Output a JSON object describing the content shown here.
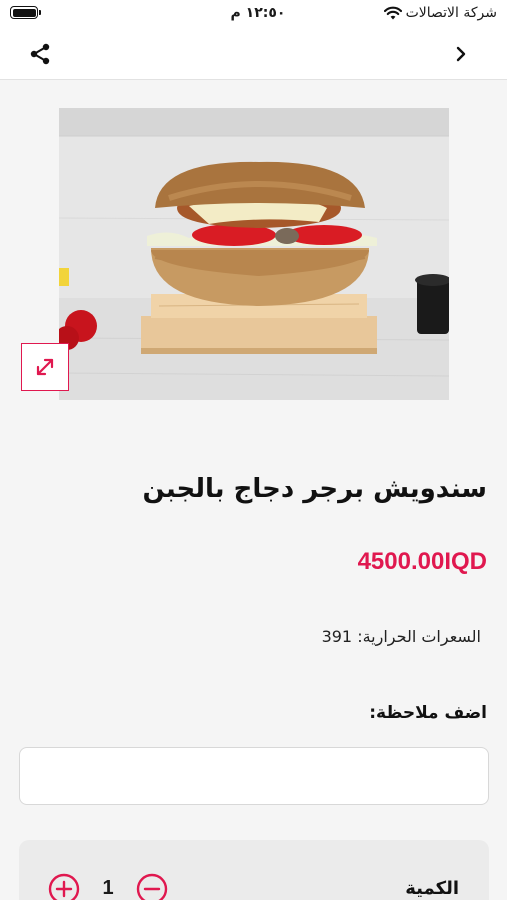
{
  "status_bar": {
    "time": "١٢:٥٠ م",
    "carrier": "شركة الاتصالات"
  },
  "nav": {
    "share_icon": "share-icon",
    "back_icon": "chevron-right-icon"
  },
  "product": {
    "image_alt": "burger-photo",
    "name": "سندويش برجر دجاج بالجبن",
    "price": "4500.00IQD",
    "calories": "السعرات الحرارية: 391"
  },
  "note": {
    "label": "اضف ملاحظة:",
    "value": "",
    "placeholder": ""
  },
  "quantity": {
    "label": "الكمية",
    "value": "1"
  },
  "colors": {
    "accent": "#e0184f",
    "background": "#f5f5f5",
    "card": "#ebebeb"
  }
}
